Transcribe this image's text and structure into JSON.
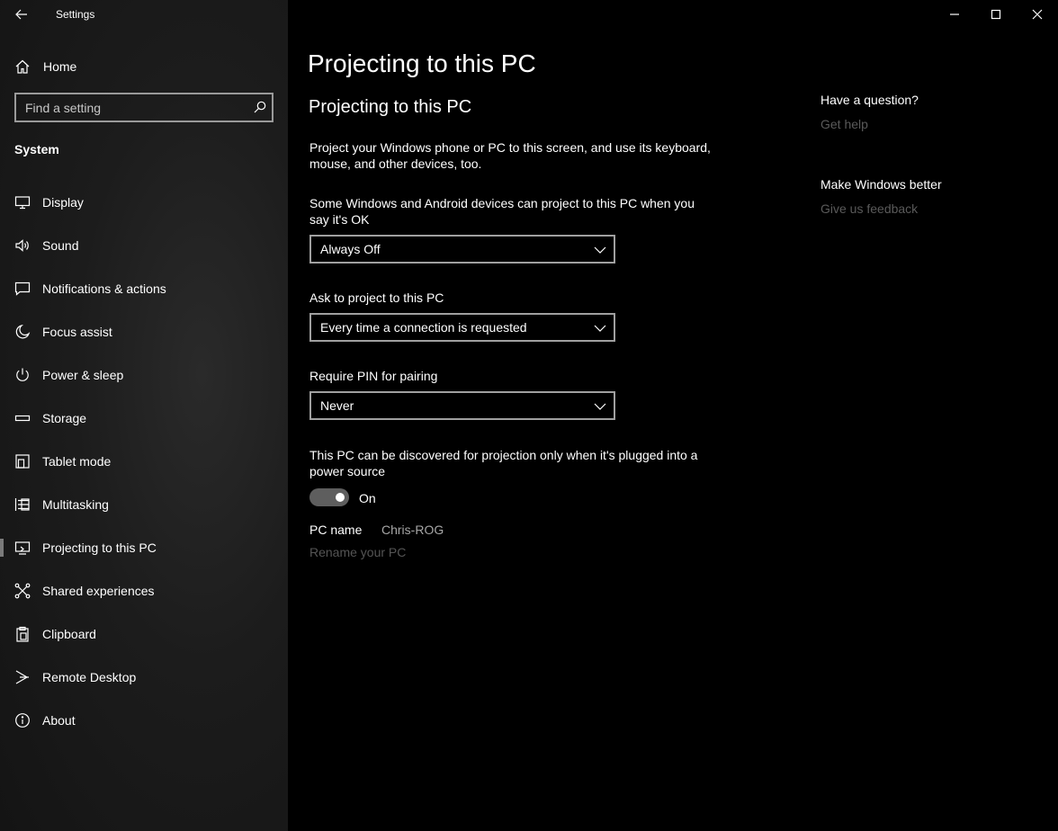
{
  "window": {
    "title": "Settings"
  },
  "sidebar": {
    "home_label": "Home",
    "search_placeholder": "Find a setting",
    "section": "System",
    "items": [
      {
        "label": "Display",
        "icon": "monitor-icon"
      },
      {
        "label": "Sound",
        "icon": "speaker-icon"
      },
      {
        "label": "Notifications & actions",
        "icon": "message-icon"
      },
      {
        "label": "Focus assist",
        "icon": "moon-icon"
      },
      {
        "label": "Power & sleep",
        "icon": "power-icon"
      },
      {
        "label": "Storage",
        "icon": "storage-icon"
      },
      {
        "label": "Tablet mode",
        "icon": "tablet-icon"
      },
      {
        "label": "Multitasking",
        "icon": "multitasking-icon"
      },
      {
        "label": "Projecting to this PC",
        "icon": "projecting-icon",
        "selected": true
      },
      {
        "label": "Shared experiences",
        "icon": "shared-icon"
      },
      {
        "label": "Clipboard",
        "icon": "clipboard-icon"
      },
      {
        "label": "Remote Desktop",
        "icon": "remote-desktop-icon"
      },
      {
        "label": "About",
        "icon": "info-icon"
      }
    ]
  },
  "main": {
    "page_title": "Projecting to this PC",
    "sub_title": "Projecting to this PC",
    "description": "Project your Windows phone or PC to this screen, and use its keyboard, mouse, and other devices, too.",
    "setting1": {
      "label": "Some Windows and Android devices can project to this PC when you say it's OK",
      "value": "Always Off"
    },
    "setting2": {
      "label": "Ask to project to this PC",
      "value": "Every time a connection is requested"
    },
    "setting3": {
      "label": "Require PIN for pairing",
      "value": "Never"
    },
    "setting4": {
      "label": "This PC can be discovered for projection only when it's plugged into a power source",
      "toggle_state": "On"
    },
    "pc_name_label": "PC name",
    "pc_name_value": "Chris-ROG",
    "rename_link": "Rename your PC"
  },
  "right": {
    "question_heading": "Have a question?",
    "get_help": "Get help",
    "better_heading": "Make Windows better",
    "feedback": "Give us feedback"
  },
  "colors": {
    "background": "#000000",
    "sidebar": "#1c1c1c",
    "dropdown_border": "#a0a0a0",
    "disabled_text": "#5a5a5a",
    "toggle_track": "#5e5e5e"
  }
}
